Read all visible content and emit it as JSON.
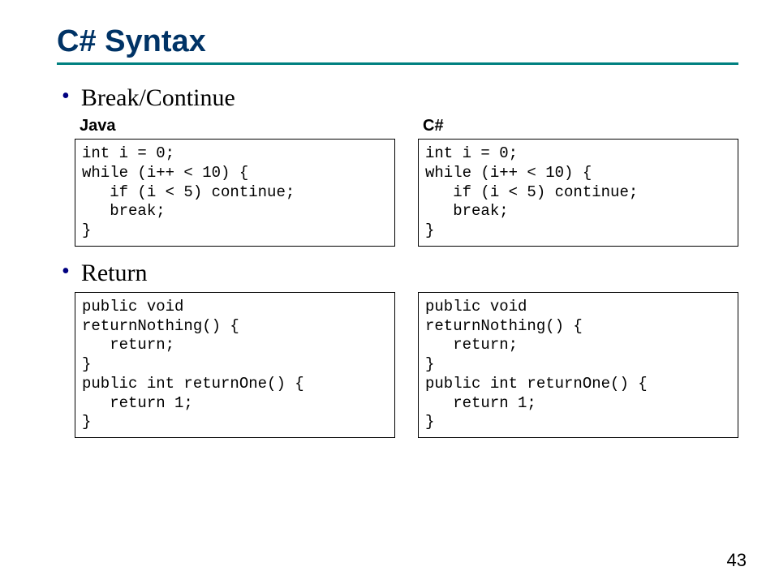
{
  "title": "C# Syntax",
  "bullets": {
    "breakContinue": "Break/Continue",
    "return": "Return"
  },
  "labels": {
    "java": "Java",
    "csharp": "C#"
  },
  "code": {
    "breakContinue": {
      "java": "int i = 0;\nwhile (i++ < 10) {\n   if (i < 5) continue;\n   break;\n}",
      "csharp": "int i = 0;\nwhile (i++ < 10) {\n   if (i < 5) continue;\n   break;\n}"
    },
    "return": {
      "java": "public void\nreturnNothing() {\n   return;\n}\npublic int returnOne() {\n   return 1;\n}",
      "csharp": "public void\nreturnNothing() {\n   return;\n}\npublic int returnOne() {\n   return 1;\n}"
    }
  },
  "pageNumber": "43"
}
